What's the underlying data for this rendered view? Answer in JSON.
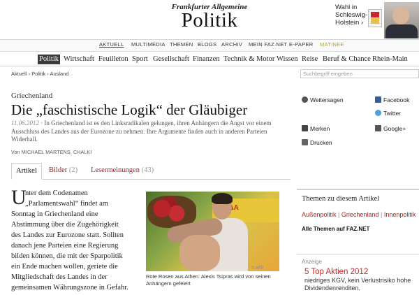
{
  "masthead": {
    "logo": "Frankfurter Allgemeine",
    "section_title": "Politik"
  },
  "promo": {
    "text": "Wahl in Schleswig-Holstein ›"
  },
  "top_nav": {
    "items": [
      "AKTUELL",
      "MULTIMEDIA",
      "THEMEN",
      "BLOGS",
      "ARCHIV",
      "MEIN FAZ.NET",
      "E-PAPER",
      "MATINEE"
    ]
  },
  "section_nav": {
    "items": [
      "Politik",
      "Wirtschaft",
      "Feuilleton",
      "Sport",
      "Gesellschaft",
      "Finanzen",
      "Technik & Motor",
      "Wissen",
      "Reise",
      "Beruf & Chance",
      "Rhein-Main"
    ]
  },
  "breadcrumb": {
    "items": [
      "Aktuell",
      "Politik",
      "Ausland"
    ]
  },
  "search": {
    "placeholder": "Suchbegriff eingeben"
  },
  "article": {
    "kicker": "Griechenland",
    "headline": "Die „faschistische Logik“ der Gläubiger",
    "date": "11.06.2012",
    "teaser": "· In Griechenland ist es den Linksradikalen gelungen, ihren Anhängern die Angst vor einem Ausschluss des Landes aus der Eurozone zu nehmen. Ihre Argumente finden auch in anderen Parteien Widerhall.",
    "author": "Von MICHAEL MARTENS, CHALKI",
    "dropcap": "U",
    "body_lines": [
      "nter dem Codenamen",
      "„Parlamentswahl“ findet am",
      "Sonntag in Griechenland eine",
      "Abstimmung über die Zugehörigkeit",
      "des Landes zur Eurozone statt. Sollten",
      "danach jene Parteien eine Regierung",
      "bilden können, die mit der Sparpolitik",
      "ein Ende machen wollen, geriete die",
      "Mitgliedschaft des Landes in der",
      "gemeinsamen Währungszone in Gefahr."
    ]
  },
  "tools": {
    "weitersagen": "Weitersagen",
    "facebook": "Facebook",
    "twitter": "Twitter",
    "merken": "Merken",
    "google": "Google+",
    "drucken": "Drucken"
  },
  "tabs": [
    {
      "label": "Artikel",
      "count": ""
    },
    {
      "label": "Bilder",
      "count": "(2)"
    },
    {
      "label": "Lesermeinungen",
      "count": "(43)"
    }
  ],
  "photo": {
    "banner_text": "ΔΑΔΑ",
    "credit": "© AFP",
    "caption": "Rote Rosen aus Athen: Alexis Tsipras wird von seinen Anhängern gefeiert"
  },
  "themes": {
    "title": "Themen zu diesem Artikel",
    "links": [
      "Außenpolitik",
      "Griechenland",
      "Innenpolitik"
    ],
    "all": "Alle Themen auf FAZ.NET"
  },
  "ad": {
    "label": "Anzeige",
    "title": "5 Top Aktien 2012",
    "text": "niedriges KGV, kein Verlustrisiko hohe Dividendenrenditen."
  },
  "colors": {
    "accent_red": "#b01e1e",
    "active_nav_bg": "#3b3b3b",
    "matinee_gold": "#c8a000"
  }
}
